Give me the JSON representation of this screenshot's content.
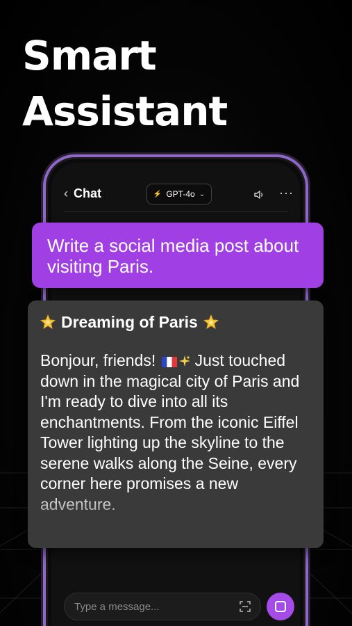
{
  "headline": {
    "line1": "Smart",
    "line2": "Assistant"
  },
  "chat": {
    "back_label": "Chat",
    "model_label": "GPT-4o",
    "input_placeholder": "Type a message...",
    "user_message": "Write a social media post about visiting Paris.",
    "ai_title": "Dreaming of Paris",
    "ai_body_start": "Bonjour, friends!",
    "ai_body_rest": "Just touched down in the magical city of Paris and I'm ready to dive into all its enchantments. From the iconic Eiffel Tower lighting up the skyline to the serene walks along the Seine, every corner here promises a new adventure."
  },
  "icons": {
    "back": "chevron-left-icon",
    "model": "bolt-icon",
    "dropdown": "chevron-down-icon",
    "speaker": "speaker-icon",
    "more": "more-icon",
    "scan": "scan-icon",
    "send": "stop-icon",
    "star": "star-icon",
    "flag": "france-flag-icon",
    "sparkle": "sparkle-icon"
  },
  "colors": {
    "accent": "#a03fe3",
    "phone_frame": "#8f67c9",
    "ai_bubble": "#3a3a3a",
    "background": "#000000"
  }
}
